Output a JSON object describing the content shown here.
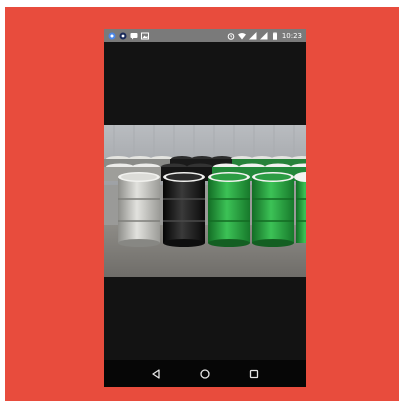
{
  "colors": {
    "backdrop": "#e84c3d",
    "screen_bg": "#131313",
    "status_bar": "#7a7a7a",
    "nav_bar": "#060606",
    "barrel_grey": "#c9c9c4",
    "barrel_black": "#1b1b1b",
    "barrel_green": "#2a9a3e",
    "barrel_white_rim": "#eeeeee"
  },
  "status_bar": {
    "left_icons": [
      "chrome-icon",
      "app-icon",
      "message-icon",
      "image-icon"
    ],
    "right_icons": [
      "alarm-icon",
      "wifi-icon",
      "signal-icon",
      "signal-icon",
      "battery-icon"
    ],
    "time": "10:23"
  },
  "photo": {
    "subject": ""
  },
  "nav_bar": {
    "buttons": [
      "back-icon",
      "home-icon",
      "recents-icon"
    ]
  }
}
